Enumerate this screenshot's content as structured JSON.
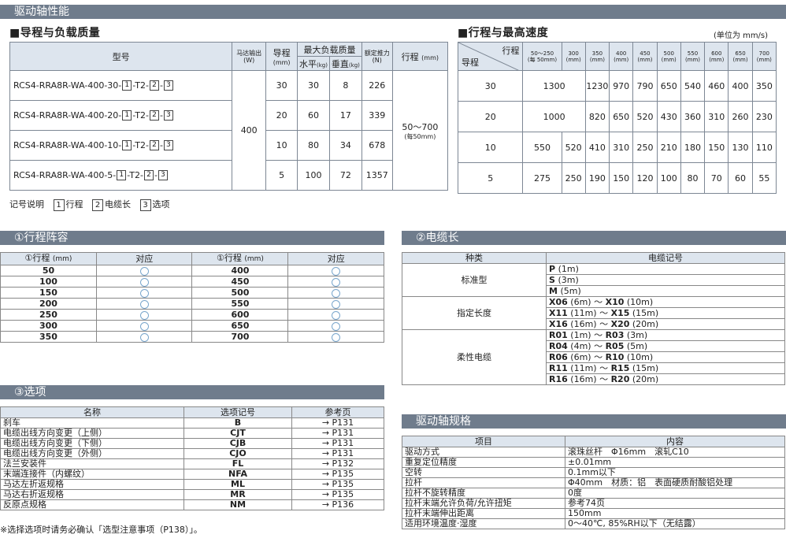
{
  "header": {
    "title": "驱动轴性能"
  },
  "left_table": {
    "title": "■导程与负载质量",
    "head_model": "型号",
    "head_motor": "马达输出",
    "head_motor_unit": "(W)",
    "head_lead": "导程",
    "head_lead_unit": "(mm)",
    "head_load": "最大负载质量",
    "head_horizontal": "水平",
    "head_vertical": "垂直",
    "head_kg": "(kg)",
    "head_thrust": "额定推力",
    "head_thrust_unit": "(N)",
    "head_stroke": "行程",
    "head_stroke_unit": "(mm)",
    "motor_value": "400",
    "stroke_value": "50～700",
    "stroke_value_sub": "(每50mm)",
    "rows": [
      {
        "model_prefix": "RCS4-RRA8R-WA-400-30-",
        "b1": "1",
        "mid": "-T2-",
        "b2": "2",
        "dash": "-",
        "b3": "3",
        "lead": "30",
        "h": "30",
        "v": "8",
        "thrust": "226"
      },
      {
        "model_prefix": "RCS4-RRA8R-WA-400-20-",
        "b1": "1",
        "mid": "-T2-",
        "b2": "2",
        "dash": "-",
        "b3": "3",
        "lead": "20",
        "h": "60",
        "v": "17",
        "thrust": "339"
      },
      {
        "model_prefix": "RCS4-RRA8R-WA-400-10-",
        "b1": "1",
        "mid": "-T2-",
        "b2": "2",
        "dash": "-",
        "b3": "3",
        "lead": "10",
        "h": "80",
        "v": "34",
        "thrust": "678"
      },
      {
        "model_prefix": "RCS4-RRA8R-WA-400-5-",
        "b1": "1",
        "mid": "-T2-",
        "b2": "2",
        "dash": "-",
        "b3": "3",
        "lead": "5",
        "h": "100",
        "v": "72",
        "thrust": "1357"
      }
    ]
  },
  "right_table": {
    "title": "■行程与最高速度",
    "unit_note": "(单位为 mm/s)",
    "corner_top": "行程",
    "corner_bottom": "导程",
    "cols": [
      {
        "a": "50～250",
        "b": "(每 50mm)"
      },
      {
        "a": "300",
        "b": "(mm)"
      },
      {
        "a": "350",
        "b": "(mm)"
      },
      {
        "a": "400",
        "b": "(mm)"
      },
      {
        "a": "450",
        "b": "(mm)"
      },
      {
        "a": "500",
        "b": "(mm)"
      },
      {
        "a": "550",
        "b": "(mm)"
      },
      {
        "a": "600",
        "b": "(mm)"
      },
      {
        "a": "650",
        "b": "(mm)"
      },
      {
        "a": "700",
        "b": "(mm)"
      }
    ],
    "rows": [
      {
        "lead": "30",
        "c1": "1300",
        "c3": "1230",
        "c4": "970",
        "c5": "790",
        "c6": "650",
        "c7": "540",
        "c8": "460",
        "c9": "400",
        "c10": "350"
      },
      {
        "lead": "20",
        "c1": "1000",
        "c3": "820",
        "c4": "650",
        "c5": "520",
        "c6": "430",
        "c7": "360",
        "c8": "310",
        "c9": "260",
        "c10": "230"
      },
      {
        "lead": "10",
        "c1": "550",
        "c2": "520",
        "c3": "410",
        "c4": "310",
        "c5": "250",
        "c6": "210",
        "c7": "180",
        "c8": "150",
        "c9": "130",
        "c10": "110"
      },
      {
        "lead": "5",
        "c1": "275",
        "c2": "250",
        "c3": "190",
        "c4": "150",
        "c5": "120",
        "c6": "100",
        "c7": "80",
        "c8": "70",
        "c9": "60",
        "c10": "55"
      }
    ]
  },
  "legend": {
    "label": "记号说明",
    "n1": "1",
    "t1": "行程",
    "n2": "2",
    "t2": "电缆长",
    "n3": "3",
    "t3": "选项"
  },
  "stroke_section": {
    "title": "①行程阵容",
    "head_stroke": "①行程",
    "head_unit": "(mm)",
    "head_support": "对应",
    "left": [
      "50",
      "100",
      "150",
      "200",
      "250",
      "300",
      "350"
    ],
    "right": [
      "400",
      "450",
      "500",
      "550",
      "600",
      "650",
      "700"
    ]
  },
  "cable_section": {
    "title": "②电缆长",
    "head_type": "种类",
    "head_code": "电缆记号",
    "groups": [
      {
        "type": "标准型",
        "lines": [
          [
            "P",
            "(1m)",
            "",
            ""
          ],
          [
            "S",
            "(3m)",
            "",
            ""
          ],
          [
            "M",
            "(5m)",
            "",
            ""
          ]
        ]
      },
      {
        "type": "指定长度",
        "lines": [
          [
            "X06",
            "(6m)",
            "X10",
            "(10m)"
          ],
          [
            "X11",
            "(11m)",
            "X15",
            "(15m)"
          ],
          [
            "X16",
            "(16m)",
            "X20",
            "(20m)"
          ]
        ]
      },
      {
        "type": "柔性电缆",
        "lines": [
          [
            "R01",
            "(1m)",
            "R03",
            "(3m)"
          ],
          [
            "R04",
            "(4m)",
            "R05",
            "(5m)"
          ],
          [
            "R06",
            "(6m)",
            "R10",
            "(10m)"
          ],
          [
            "R11",
            "(11m)",
            "R15",
            "(15m)"
          ],
          [
            "R16",
            "(16m)",
            "R20",
            "(20m)"
          ]
        ]
      }
    ],
    "tilde": "～"
  },
  "option_section": {
    "title": "③选项",
    "head_name": "名称",
    "head_code": "选项记号",
    "head_page": "参考页",
    "rows": [
      {
        "name": "刹车",
        "code": "B",
        "page": "→ P131"
      },
      {
        "name": "电缆出线方向变更（上侧）",
        "code": "CJT",
        "page": "→ P131"
      },
      {
        "name": "电缆出线方向变更（下侧）",
        "code": "CJB",
        "page": "→ P131"
      },
      {
        "name": "电缆出线方向变更（外侧）",
        "code": "CJO",
        "page": "→ P131"
      },
      {
        "name": "法兰安装件",
        "code": "FL",
        "page": "→ P132"
      },
      {
        "name": "末端连接件（内螺纹）",
        "code": "NFA",
        "page": "→ P135"
      },
      {
        "name": "马达左折返规格",
        "code": "ML",
        "page": "→ P135"
      },
      {
        "name": "马达右折返规格",
        "code": "MR",
        "page": "→ P135"
      },
      {
        "name": "反原点规格",
        "code": "NM",
        "page": "→ P136"
      }
    ],
    "note": "※选择选项时请务必确认「选型注意事项（P138）」。"
  },
  "spec_section": {
    "title": "驱动轴规格",
    "head_item": "项目",
    "head_content": "内容",
    "rows": [
      {
        "item": "驱动方式",
        "content": "滚珠丝杆　Φ16mm　滚轧C10"
      },
      {
        "item": "重复定位精度",
        "content": "±0.01mm"
      },
      {
        "item": "空转",
        "content": "0.1mm以下"
      },
      {
        "item": "拉杆",
        "content": "Φ40mm　材质：铝　表面硬质耐酸铝处理"
      },
      {
        "item": "拉杆不旋转精度",
        "content": "0度"
      },
      {
        "item": "拉杆末端允许负荷/允许扭矩",
        "content": "参考74页"
      },
      {
        "item": "拉杆末端伸出距离",
        "content": "150mm"
      },
      {
        "item": "适用环境温度·湿度",
        "content": "0～40℃, 85%RH以下（无结露）"
      }
    ]
  },
  "colors": {
    "band": "#6f7c8c",
    "header_fill": "#dde5ee",
    "circle": "#7aa6cc"
  }
}
